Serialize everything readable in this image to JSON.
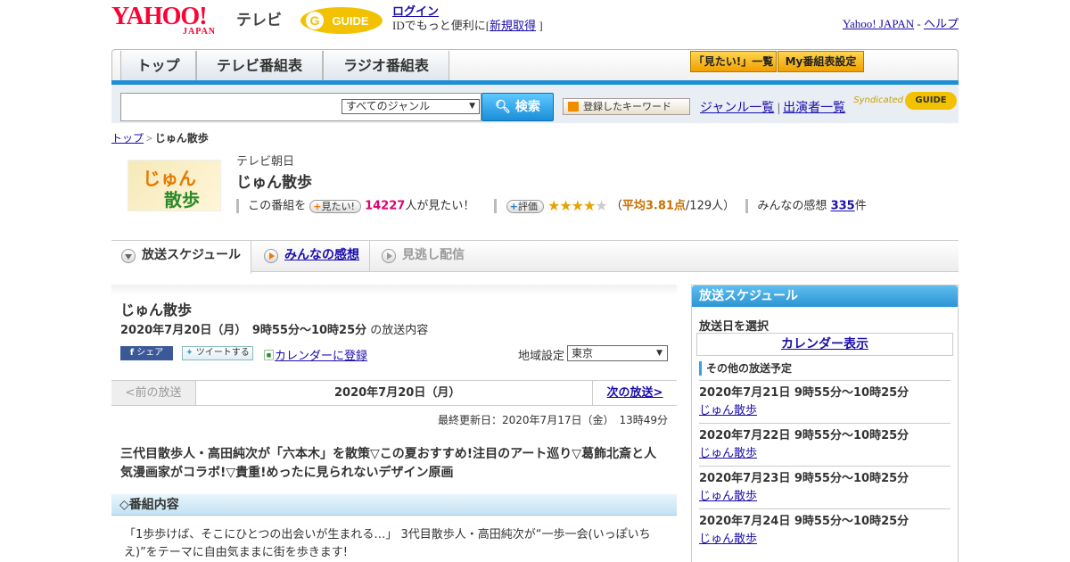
{
  "header": {
    "yahoo_logo": "YAHOO!",
    "japan_logo": "JAPAN",
    "tv_logo": "テレビ",
    "gguide_logo": "GUIDE",
    "login_label": "ログイン",
    "login_sub_prefix": "IDでもっと便利に[",
    "signup_label": "新規取得",
    "login_sub_suffix": "]",
    "yahoo_japan_link": "Yahoo! JAPAN",
    "dash": "-",
    "help_link": "ヘルプ"
  },
  "nav": {
    "tabs": [
      {
        "label": "トップ"
      },
      {
        "label": "テレビ番組表"
      },
      {
        "label": "ラジオ番組表"
      }
    ],
    "mitai_list": "「見たい!」一覧",
    "my_schedule": "My番組表設定"
  },
  "search": {
    "genre_selected": "すべてのジャンル",
    "search_button": "検索",
    "keyword_button": "登録したキーワード",
    "genre_list_link": "ジャンル一覧",
    "divider": "|",
    "cast_list_link": "出演者一覧",
    "syndicated": "Syndicated",
    "syndicated_logo": "GUIDE"
  },
  "breadcrumb": {
    "home": "トップ",
    "sep": ">",
    "current": "じゅん散歩"
  },
  "program": {
    "thumb_text_1": "じゅん",
    "thumb_text_2": "散歩",
    "station": "テレビ朝日",
    "title": "じゅん散歩",
    "this_program": "この番組を",
    "mitai_pill": "見たい!",
    "mitai_count": "14227",
    "mitai_suffix": "人が見たい！",
    "rating_pill": "評価",
    "rating": 3.81,
    "stars_on": "★★★★",
    "stars_off": "★",
    "avg_prefix": "（",
    "avg_text": "平均3.81点",
    "avg_suffix": "/129人）",
    "impressions_label": "みんなの感想",
    "impressions_count": "335",
    "impressions_suffix": "件"
  },
  "subtabs": [
    {
      "label": "放送スケジュール"
    },
    {
      "label": "みんなの感想"
    },
    {
      "label": "見逃し配信"
    }
  ],
  "main": {
    "title": "じゅん散歩",
    "datetime": "2020年7月20日（月）　9時55分～10時25分",
    "datetime_suffix": "の放送内容",
    "fb_share": "シェア",
    "tweet": "ツイートする",
    "calendar_register": "カレンダーに登録",
    "area_label": "地域設定",
    "area_selected": "東京",
    "prev_label": "<前の放送",
    "current_date": "2020年7月20日（月）",
    "next_label": "次の放送>",
    "updated": "最終更新日：2020年7月17日（金）　13時49分",
    "description": "三代目散歩人・高田純次が「六本木」を散策▽この夏おすすめ!注目のアート巡り▽葛飾北斎と人気漫画家がコラボ!▽貴重!めったに見られないデザイン原画",
    "section_head": "◇番組内容",
    "body_text": "「1歩歩けば、そこにひとつの出会いが生まれる…」 3代目散歩人・高田純次が“一歩一会(いっぽいちえ)”をテーマに自由気ままに街を歩きます!"
  },
  "side": {
    "head": "放送スケジュール",
    "select_label": "放送日を選択",
    "calendar_button": "カレンダー表示",
    "other_head": "その他の放送予定",
    "items": [
      {
        "date": "2020年7月21日  9時55分～10時25分",
        "title": "じゅん散歩"
      },
      {
        "date": "2020年7月22日  9時55分～10時25分",
        "title": "じゅん散歩"
      },
      {
        "date": "2020年7月23日  9時55分～10時25分",
        "title": "じゅん散歩"
      },
      {
        "date": "2020年7月24日  9時55分～10時25分",
        "title": "じゅん散歩"
      }
    ]
  },
  "colors": {
    "accent_blue": "#1e8fd6",
    "yahoo_red": "#ff0033",
    "mitai_pink": "#e0006e",
    "star_gold": "#e6a300"
  }
}
